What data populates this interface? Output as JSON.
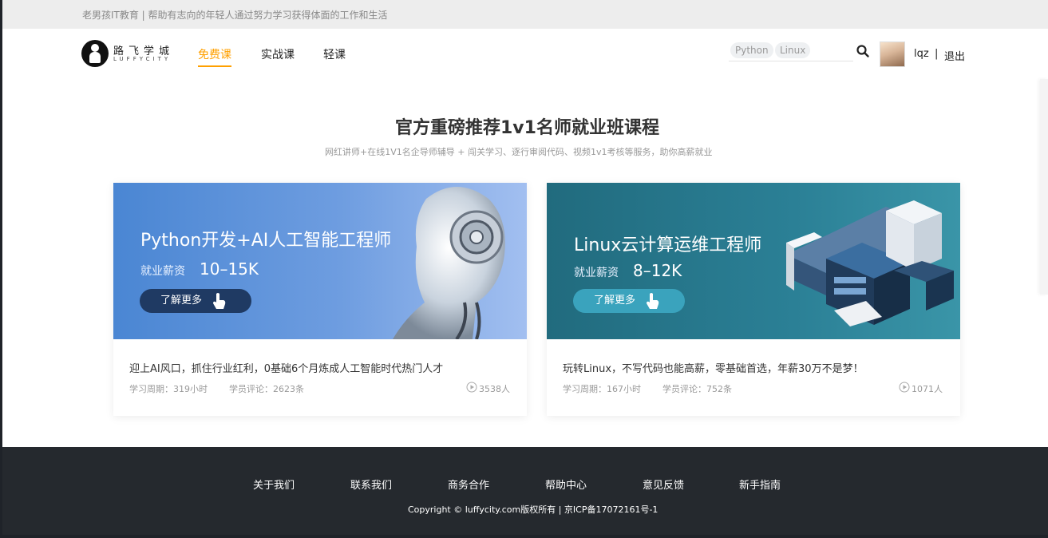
{
  "topbar": {
    "slogan": "老男孩IT教育 | 帮助有志向的年轻人通过努力学习获得体面的工作和生活"
  },
  "header": {
    "logo_cn": "路飞学城",
    "logo_en": "LUFFYCITY",
    "nav": [
      {
        "label": "免费课",
        "active": true
      },
      {
        "label": "实战课",
        "active": false
      },
      {
        "label": "轻课",
        "active": false
      }
    ],
    "search_tags": [
      "Python",
      "Linux"
    ],
    "username": "lqz",
    "separator": "|",
    "logout": "退出"
  },
  "section": {
    "title": "官方重磅推荐1v1名师就业班课程",
    "subtitle": "网红讲师+在线1V1名企导师辅导 + 闯关学习、逐行审阅代码、视频1v1考核等服务，助你高薪就业"
  },
  "courses": [
    {
      "banner_title": "Python开发+AI人工智能工程师",
      "salary_label": "就业薪资",
      "salary_value": "10–15K",
      "button_label": "了解更多",
      "description": "迎上AI风口，抓住行业红利，0基础6个月炼成人工智能时代热门人才",
      "study_period": "学习周期：319小时",
      "reviews": "学员评论：2623条",
      "learners": "3538人"
    },
    {
      "banner_title": "Linux云计算运维工程师",
      "salary_label": "就业薪资",
      "salary_value": "8–12K",
      "button_label": "了解更多",
      "description": "玩转Linux，不写代码也能高薪，零基础首选，年薪30万不是梦！",
      "study_period": "学习周期：167小时",
      "reviews": "学员评论：752条",
      "learners": "1071人"
    }
  ],
  "footer": {
    "links": [
      "关于我们",
      "联系我们",
      "商务合作",
      "帮助中心",
      "意见反馈",
      "新手指南"
    ],
    "copyright": "Copyright © luffycity.com版权所有 | 京ICP备17072161号-1"
  },
  "colors": {
    "accent": "#ffa000",
    "footer_bg": "#25292e",
    "python_banner": "#4a86d3",
    "linux_banner": "#216b7e"
  },
  "icons": [
    "search-icon",
    "hand-pointer-icon",
    "play-circle-icon"
  ]
}
